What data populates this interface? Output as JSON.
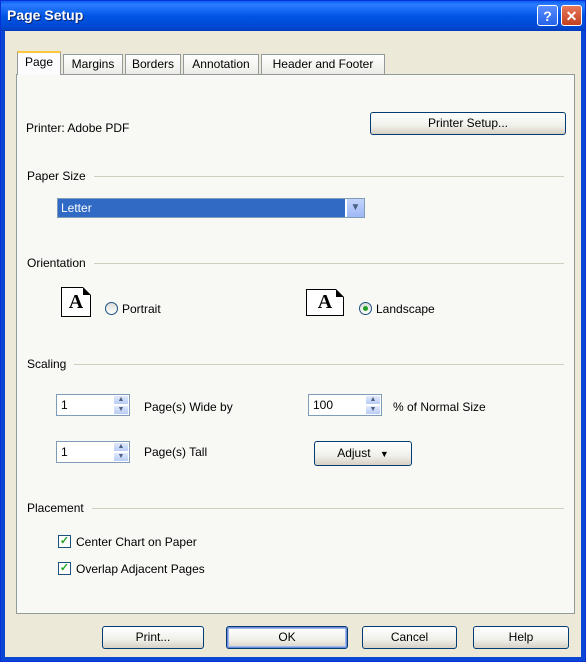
{
  "window": {
    "title": "Page Setup",
    "help_icon": "question-icon",
    "close_icon": "close-icon"
  },
  "tabs": [
    {
      "label": "Page",
      "active": true
    },
    {
      "label": "Margins"
    },
    {
      "label": "Borders"
    },
    {
      "label": "Annotation"
    },
    {
      "label": "Header and Footer"
    }
  ],
  "printer": {
    "label": "Printer: Adobe PDF",
    "setup_button": "Printer Setup..."
  },
  "paper_size": {
    "heading": "Paper Size",
    "selected": "Letter"
  },
  "orientation": {
    "heading": "Orientation",
    "portrait_label": "Portrait",
    "landscape_label": "Landscape",
    "icon_letter": "A",
    "selected": "Landscape"
  },
  "scaling": {
    "heading": "Scaling",
    "wide_value": "1",
    "wide_label": "Page(s) Wide by",
    "tall_value": "1",
    "tall_label": "Page(s) Tall",
    "percent_value": "100",
    "percent_label": "% of Normal Size",
    "adjust_label": "Adjust"
  },
  "placement": {
    "heading": "Placement",
    "center_label": "Center Chart on Paper",
    "center_checked": true,
    "overlap_label": "Overlap Adjacent Pages",
    "overlap_checked": true
  },
  "footer": {
    "print_button": "Print...",
    "ok_button": "OK",
    "cancel_button": "Cancel",
    "help_button": "Help"
  },
  "colors": {
    "title_bar": "#0055e5",
    "selection": "#316ac5",
    "check": "#21a121"
  }
}
